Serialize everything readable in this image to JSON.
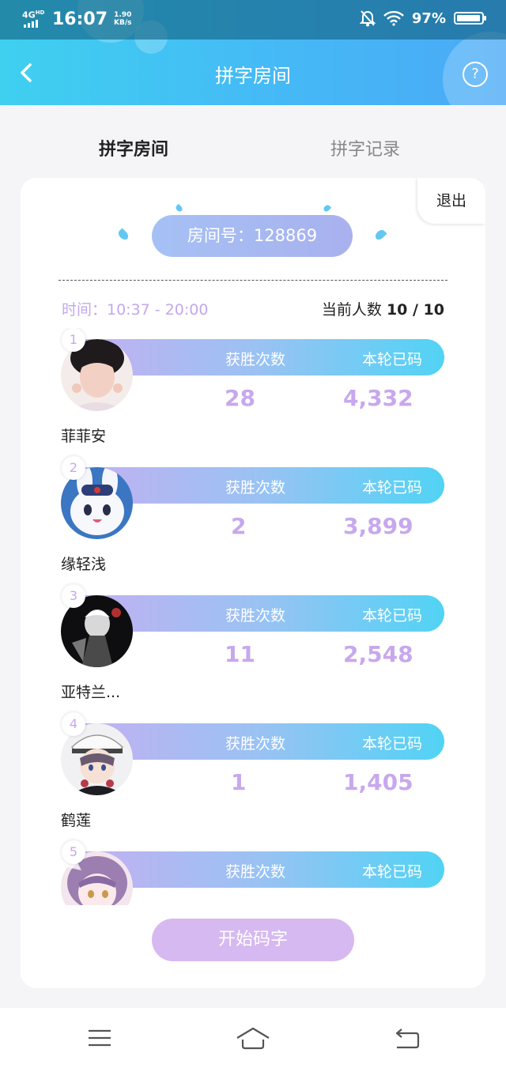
{
  "status": {
    "network": "4G",
    "network_sup": "HD",
    "time": "16:07",
    "speed_value": "1.90",
    "speed_unit": "KB/s",
    "battery": "97%",
    "battery_level": 0.97
  },
  "header": {
    "title": "拼字房间"
  },
  "tabs": [
    {
      "label": "拼字房间"
    },
    {
      "label": "拼字记录"
    }
  ],
  "room": {
    "exit_label": "退出",
    "room_number": "房间号：128869",
    "time": "时间：10:37 - 20:00",
    "count_label": "当前人数 ",
    "count_value": "10 / 10",
    "wins_header": "获胜次数",
    "typed_header": "本轮已码"
  },
  "players": [
    {
      "rank": "1",
      "name": "菲菲安",
      "wins": "28",
      "typed": "4,332"
    },
    {
      "rank": "2",
      "name": "缘轻浅",
      "wins": "2",
      "typed": "3,899"
    },
    {
      "rank": "3",
      "name": "亚特兰...",
      "wins": "11",
      "typed": "2,548"
    },
    {
      "rank": "4",
      "name": "鹤莲",
      "wins": "1",
      "typed": "1,405"
    },
    {
      "rank": "5",
      "name": "",
      "wins": "",
      "typed": ""
    }
  ],
  "start_button": "开始码字",
  "colors": {
    "accent": "#45b9f6",
    "purple_text": "#c7a8ec",
    "button": "#d6b9f0"
  }
}
